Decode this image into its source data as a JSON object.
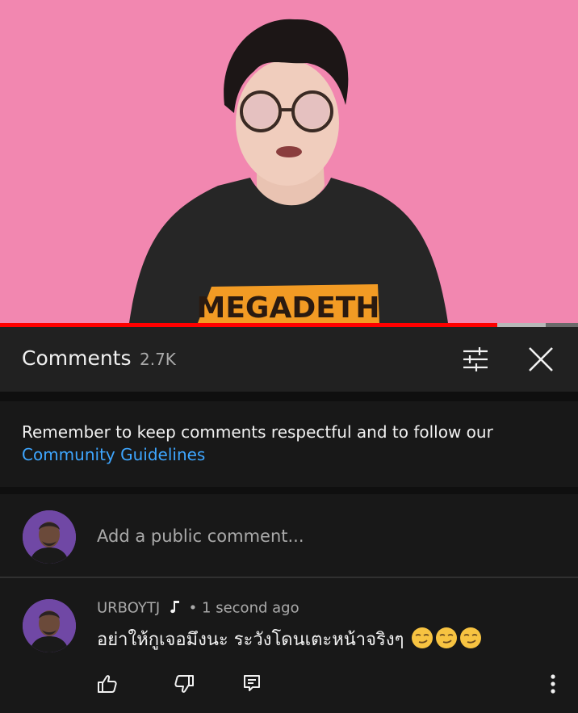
{
  "video": {
    "shirt_text": "MEGADETH",
    "progress_fraction": 0.86
  },
  "comments_panel": {
    "title": "Comments",
    "count": "2.7K"
  },
  "guidelines": {
    "text": "Remember to keep comments respectful and to follow our",
    "link": "Community Guidelines"
  },
  "add_comment": {
    "placeholder": "Add a public comment..."
  },
  "comment": {
    "author": "URBOYTJ",
    "separator": "•",
    "time": "1 second ago",
    "text": "อย่าให้กูเจอมึงนะ ระวังโดนเตะหน้าจริงๆ"
  },
  "colors": {
    "video_bg": "#f287b0",
    "accent_link": "#3ea6ff",
    "progress_red": "#ff0000",
    "panel_bg": "#212121",
    "avatar_bg": "#7048a5"
  },
  "icons": {
    "sort": "sort-filter-icon",
    "close": "close-icon",
    "like": "thumbs-up-icon",
    "dislike": "thumbs-down-icon",
    "reply": "reply-icon",
    "more": "more-vertical-icon",
    "music": "music-note-icon",
    "emoji": "smirking-face-emoji"
  }
}
